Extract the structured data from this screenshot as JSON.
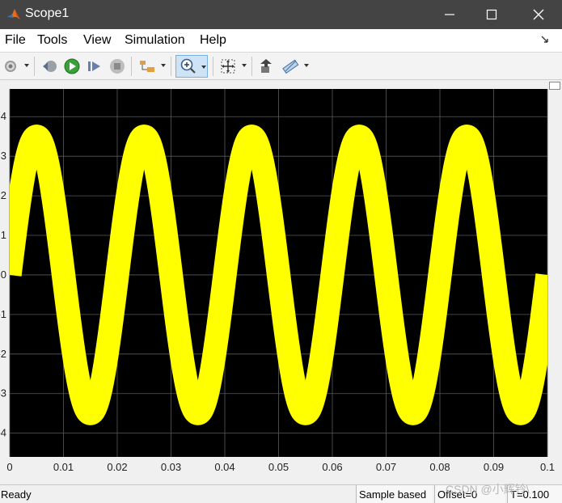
{
  "window": {
    "title": "Scope1"
  },
  "menu": {
    "items": [
      "File",
      "Tools",
      "View",
      "Simulation",
      "Help"
    ]
  },
  "toolbar": {
    "buttons": [
      "settings-icon",
      "step-back-icon",
      "run-icon",
      "step-forward-icon",
      "stop-icon",
      "signal-select-icon",
      "zoom-in-icon",
      "autoscale-icon",
      "restore-axes-icon",
      "measure-icon"
    ],
    "selected": "zoom-in-icon"
  },
  "chart_data": {
    "type": "line",
    "title": "",
    "xlabel": "",
    "ylabel": "",
    "xlim": [
      0,
      0.1
    ],
    "ylim": [
      -4.6,
      4.7
    ],
    "x_ticks": [
      "0",
      "0.01",
      "0.02",
      "0.03",
      "0.04",
      "0.05",
      "0.06",
      "0.07",
      "0.08",
      "0.09",
      "0.1"
    ],
    "y_ticks": [
      "4",
      "3",
      "2",
      "1",
      "0",
      "-1",
      "-2",
      "-3",
      "-4"
    ],
    "grid": true,
    "background": "#000000",
    "grid_color": "#5a5a5a",
    "series": [
      {
        "color": "#ffff00",
        "function": "sine",
        "amplitude": 3.5,
        "frequency_hz": 50,
        "band_halfwidth": 0.3,
        "sample_x": [
          0,
          0.0025,
          0.005,
          0.0075,
          0.01,
          0.0125,
          0.015,
          0.0175,
          0.02
        ],
        "sample_y": [
          0,
          2.47,
          3.5,
          2.47,
          0,
          -2.47,
          -3.5,
          -2.47,
          0
        ]
      }
    ]
  },
  "status": {
    "ready": "Ready",
    "sample": "Sample based",
    "offset": "Offset=0",
    "time": "T=0.100"
  },
  "watermark": "CSDN @小辉铃\\"
}
